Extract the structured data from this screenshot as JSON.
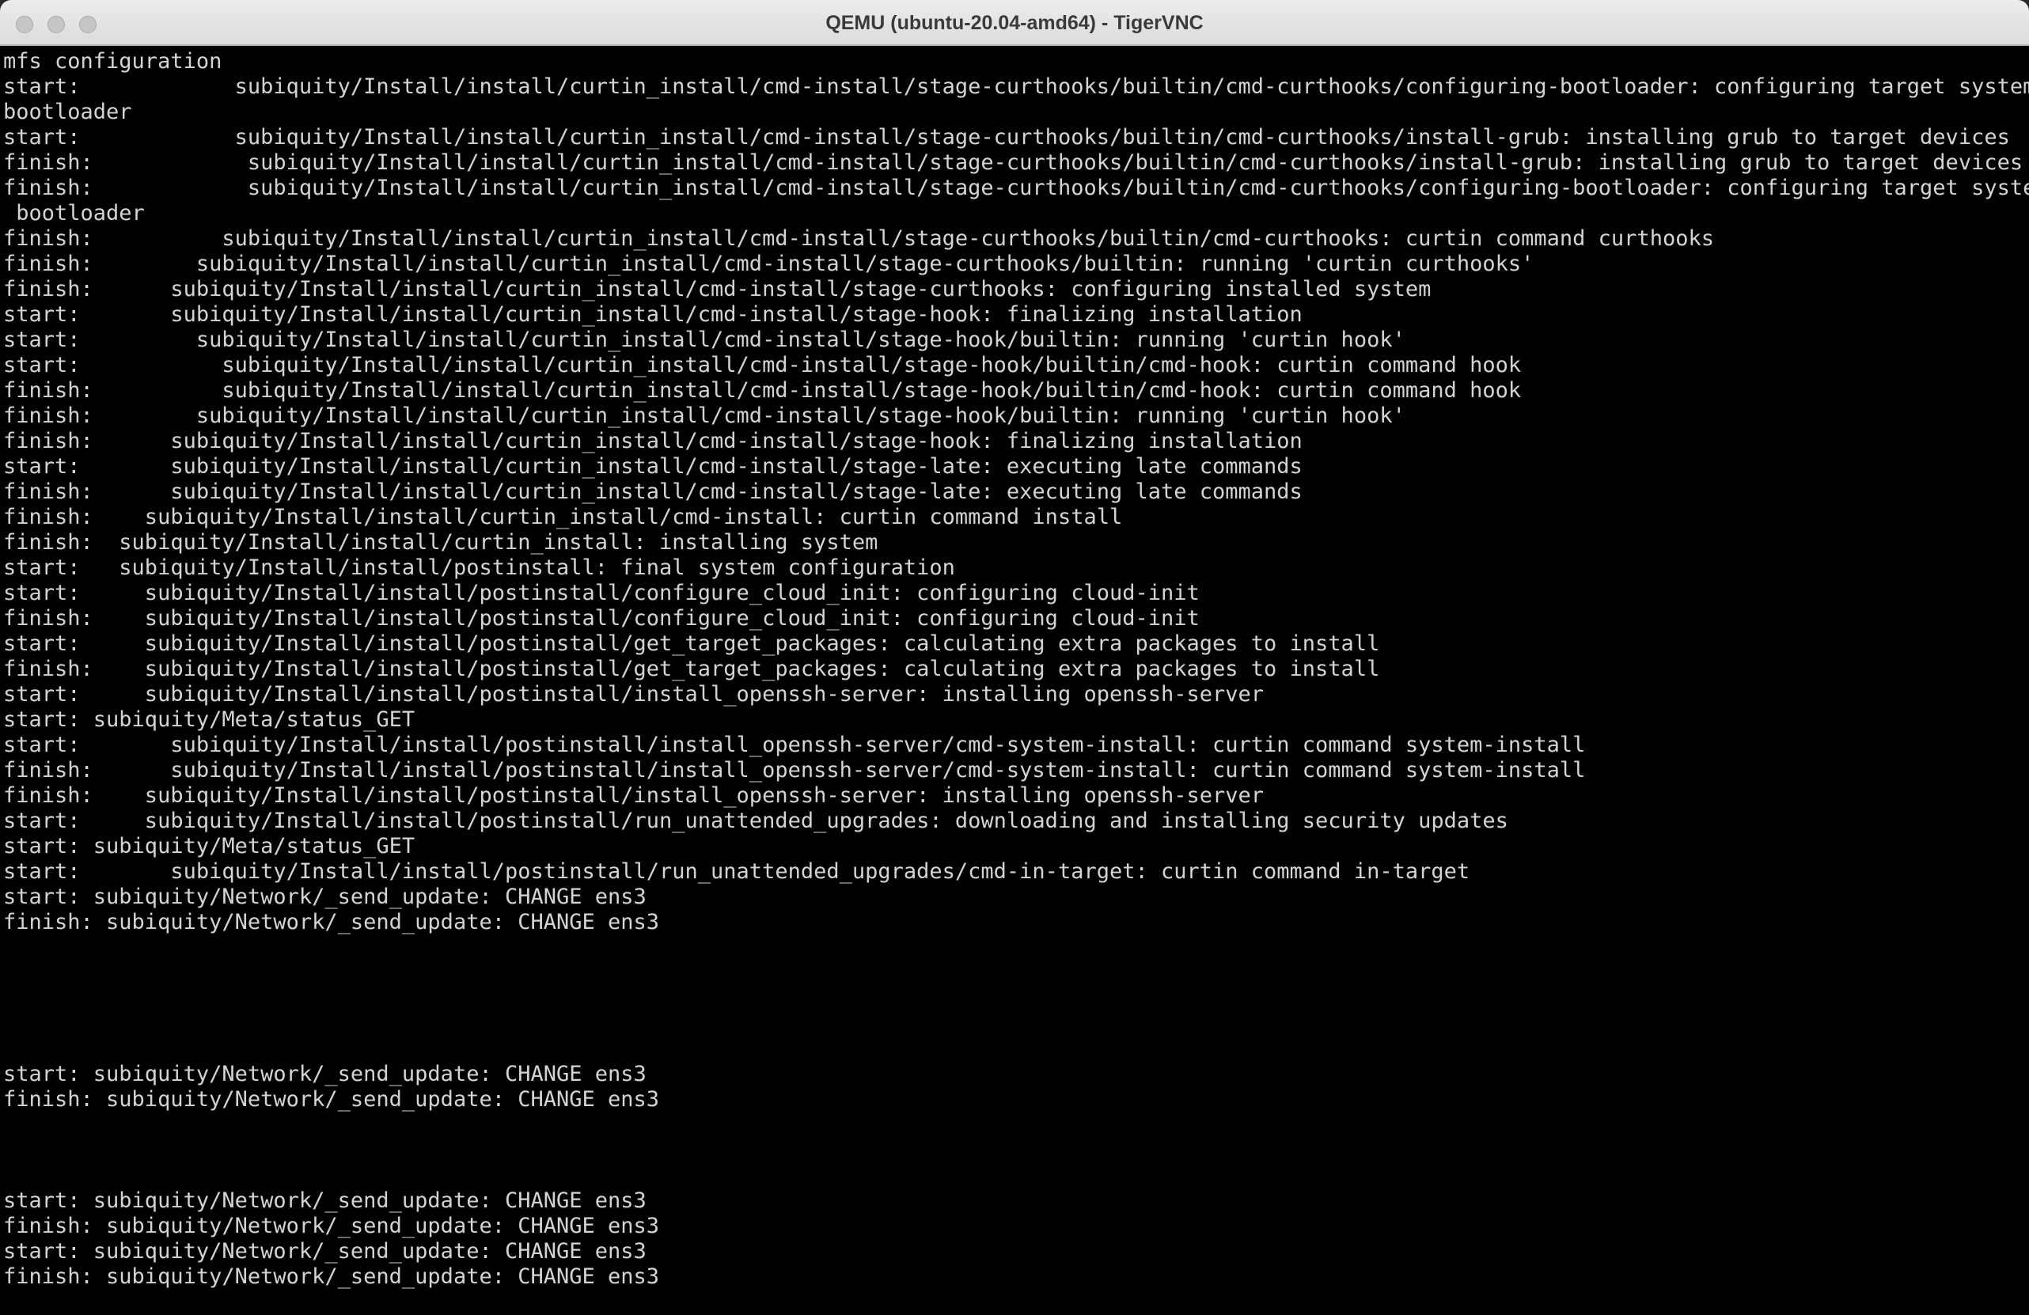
{
  "window": {
    "title": "QEMU (ubuntu-20.04-amd64) - TigerVNC"
  },
  "console": {
    "lines": [
      "mfs configuration",
      "start:            subiquity/Install/install/curtin_install/cmd-install/stage-curthooks/builtin/cmd-curthooks/configuring-bootloader: configuring target system",
      "bootloader",
      "start:            subiquity/Install/install/curtin_install/cmd-install/stage-curthooks/builtin/cmd-curthooks/install-grub: installing grub to target devices",
      "finish:            subiquity/Install/install/curtin_install/cmd-install/stage-curthooks/builtin/cmd-curthooks/install-grub: installing grub to target devices",
      "finish:            subiquity/Install/install/curtin_install/cmd-install/stage-curthooks/builtin/cmd-curthooks/configuring-bootloader: configuring target system",
      " bootloader",
      "finish:          subiquity/Install/install/curtin_install/cmd-install/stage-curthooks/builtin/cmd-curthooks: curtin command curthooks",
      "finish:        subiquity/Install/install/curtin_install/cmd-install/stage-curthooks/builtin: running 'curtin curthooks'",
      "finish:      subiquity/Install/install/curtin_install/cmd-install/stage-curthooks: configuring installed system",
      "start:       subiquity/Install/install/curtin_install/cmd-install/stage-hook: finalizing installation",
      "start:         subiquity/Install/install/curtin_install/cmd-install/stage-hook/builtin: running 'curtin hook'",
      "start:           subiquity/Install/install/curtin_install/cmd-install/stage-hook/builtin/cmd-hook: curtin command hook",
      "finish:          subiquity/Install/install/curtin_install/cmd-install/stage-hook/builtin/cmd-hook: curtin command hook",
      "finish:        subiquity/Install/install/curtin_install/cmd-install/stage-hook/builtin: running 'curtin hook'",
      "finish:      subiquity/Install/install/curtin_install/cmd-install/stage-hook: finalizing installation",
      "start:       subiquity/Install/install/curtin_install/cmd-install/stage-late: executing late commands",
      "finish:      subiquity/Install/install/curtin_install/cmd-install/stage-late: executing late commands",
      "finish:    subiquity/Install/install/curtin_install/cmd-install: curtin command install",
      "finish:  subiquity/Install/install/curtin_install: installing system",
      "start:   subiquity/Install/install/postinstall: final system configuration",
      "start:     subiquity/Install/install/postinstall/configure_cloud_init: configuring cloud-init",
      "finish:    subiquity/Install/install/postinstall/configure_cloud_init: configuring cloud-init",
      "start:     subiquity/Install/install/postinstall/get_target_packages: calculating extra packages to install",
      "finish:    subiquity/Install/install/postinstall/get_target_packages: calculating extra packages to install",
      "start:     subiquity/Install/install/postinstall/install_openssh-server: installing openssh-server",
      "start: subiquity/Meta/status_GET",
      "start:       subiquity/Install/install/postinstall/install_openssh-server/cmd-system-install: curtin command system-install",
      "finish:      subiquity/Install/install/postinstall/install_openssh-server/cmd-system-install: curtin command system-install",
      "finish:    subiquity/Install/install/postinstall/install_openssh-server: installing openssh-server",
      "start:     subiquity/Install/install/postinstall/run_unattended_upgrades: downloading and installing security updates",
      "start: subiquity/Meta/status_GET",
      "start:       subiquity/Install/install/postinstall/run_unattended_upgrades/cmd-in-target: curtin command in-target",
      "start: subiquity/Network/_send_update: CHANGE ens3",
      "finish: subiquity/Network/_send_update: CHANGE ens3",
      "",
      "",
      "",
      "",
      "",
      "start: subiquity/Network/_send_update: CHANGE ens3",
      "finish: subiquity/Network/_send_update: CHANGE ens3",
      "",
      "",
      "",
      "start: subiquity/Network/_send_update: CHANGE ens3",
      "finish: subiquity/Network/_send_update: CHANGE ens3",
      "start: subiquity/Network/_send_update: CHANGE ens3",
      "finish: subiquity/Network/_send_update: CHANGE ens3"
    ],
    "prompt": "_"
  }
}
